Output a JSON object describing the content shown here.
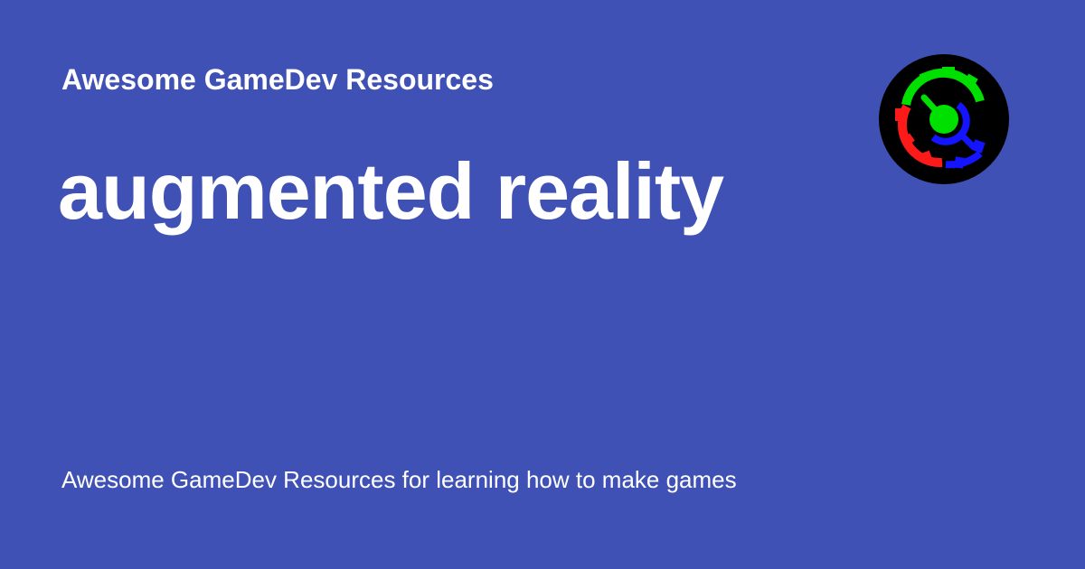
{
  "site": {
    "name": "Awesome GameDev Resources"
  },
  "page": {
    "title": "augmented reality",
    "description": "Awesome GameDev Resources for learning how to make games"
  },
  "logo": {
    "icon": "gear-logo-icon",
    "colors": {
      "background": "#000000",
      "top_gear": "#00e000",
      "left_gear": "#ff1a1a",
      "right_gear": "#1414ff"
    }
  },
  "theme": {
    "background": "#3f51b5",
    "text": "#ffffff"
  }
}
